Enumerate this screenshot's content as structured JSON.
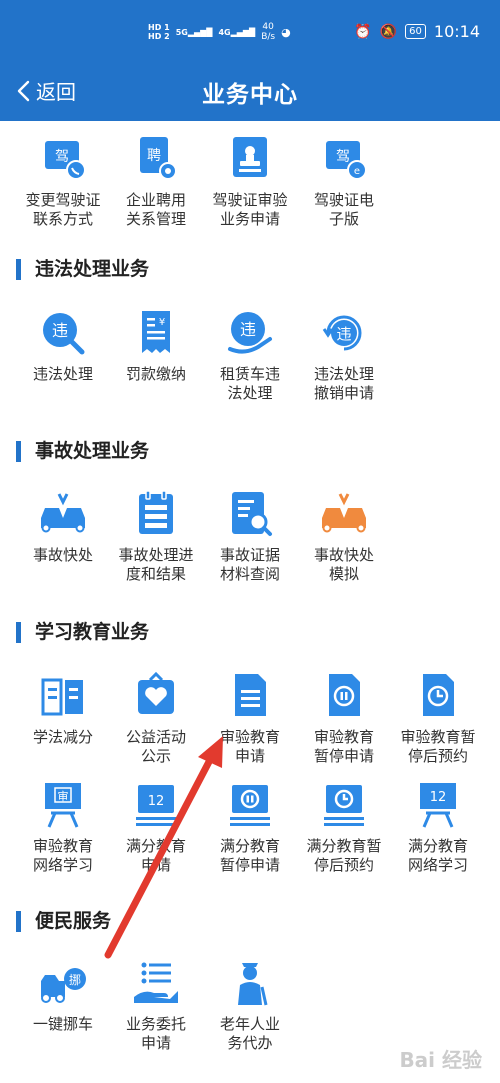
{
  "status_bar": {
    "sim1": "HD 1",
    "sim2": "HD 2",
    "signal1": "5G",
    "signal2": "4G",
    "net_speed_value": "40",
    "net_speed_unit": "B/s",
    "battery": "60",
    "time": "10:14"
  },
  "nav": {
    "back_label": "返回",
    "title": "业务中心"
  },
  "top_row": [
    {
      "label_l1": "变更驾驶证",
      "label_l2": "联系方式"
    },
    {
      "label_l1": "企业聘用",
      "label_l2": "关系管理"
    },
    {
      "label_l1": "驾驶证审验",
      "label_l2": "业务申请"
    },
    {
      "label_l1": "驾驶证电",
      "label_l2": "子版"
    }
  ],
  "sections": [
    {
      "title": "违法处理业务",
      "items": [
        {
          "label_l1": "违法处理",
          "label_l2": ""
        },
        {
          "label_l1": "罚款缴纳",
          "label_l2": ""
        },
        {
          "label_l1": "租赁车违",
          "label_l2": "法处理"
        },
        {
          "label_l1": "违法处理",
          "label_l2": "撤销申请"
        }
      ]
    },
    {
      "title": "事故处理业务",
      "items": [
        {
          "label_l1": "事故快处",
          "label_l2": ""
        },
        {
          "label_l1": "事故处理进",
          "label_l2": "度和结果"
        },
        {
          "label_l1": "事故证据",
          "label_l2": "材料查阅"
        },
        {
          "label_l1": "事故快处",
          "label_l2": "模拟"
        }
      ]
    },
    {
      "title": "学习教育业务",
      "items": [
        {
          "label_l1": "学法减分",
          "label_l2": ""
        },
        {
          "label_l1": "公益活动",
          "label_l2": "公示"
        },
        {
          "label_l1": "审验教育",
          "label_l2": "申请"
        },
        {
          "label_l1": "审验教育",
          "label_l2": "暂停申请"
        },
        {
          "label_l1": "审验教育暂",
          "label_l2": "停后预约"
        },
        {
          "label_l1": "审验教育",
          "label_l2": "网络学习"
        },
        {
          "label_l1": "满分教育",
          "label_l2": "申请"
        },
        {
          "label_l1": "满分教育",
          "label_l2": "暂停申请"
        },
        {
          "label_l1": "满分教育暂",
          "label_l2": "停后预约"
        },
        {
          "label_l1": "满分教育",
          "label_l2": "网络学习"
        }
      ]
    },
    {
      "title": "便民服务",
      "items": [
        {
          "label_l1": "一键挪车",
          "label_l2": ""
        },
        {
          "label_l1": "业务委托",
          "label_l2": "申请"
        },
        {
          "label_l1": "老年人业",
          "label_l2": "务代办"
        }
      ]
    }
  ],
  "icon_glyphs": {
    "jia": "驾",
    "pin": "聘",
    "wei": "违",
    "yen": "¥",
    "shen": "审",
    "twelve": "12",
    "nuo": "挪"
  },
  "watermark": "Bai 经验",
  "colors": {
    "brand_blue": "#2273c9",
    "icon_blue": "#2e8ae6",
    "accent_orange": "#f08a3e",
    "arrow_red": "#e23a2e"
  }
}
